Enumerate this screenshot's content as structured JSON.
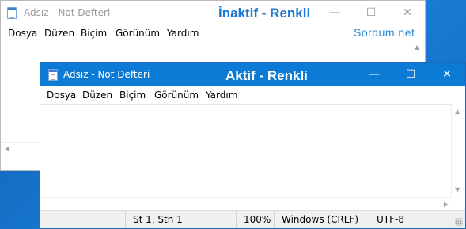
{
  "inactive_window": {
    "title": "Adsız - Not Defteri",
    "overlay_label": "İnaktif - Renkli",
    "menu": [
      "Dosya",
      "Düzen",
      "Biçim",
      "Görünüm",
      "Yardım"
    ],
    "controls": {
      "minimize": "—",
      "maximize": "☐",
      "close": "✕"
    }
  },
  "active_window": {
    "title": "Adsız - Not Defteri",
    "overlay_label": "Aktif - Renkli",
    "menu": [
      "Dosya",
      "Düzen",
      "Biçim",
      "Görünüm",
      "Yardım"
    ],
    "controls": {
      "minimize": "—",
      "maximize": "☐",
      "close": "✕"
    },
    "statusbar": {
      "position": "St 1, Stn 1",
      "zoom": "100%",
      "line_endings": "Windows (CRLF)",
      "encoding": "UTF-8"
    }
  },
  "watermark": "Sordum.net",
  "colors": {
    "active_titlebar": "#0c7bd6",
    "inactive_titlebar": "#ffffff",
    "inactive_label": "#1c79d3"
  }
}
